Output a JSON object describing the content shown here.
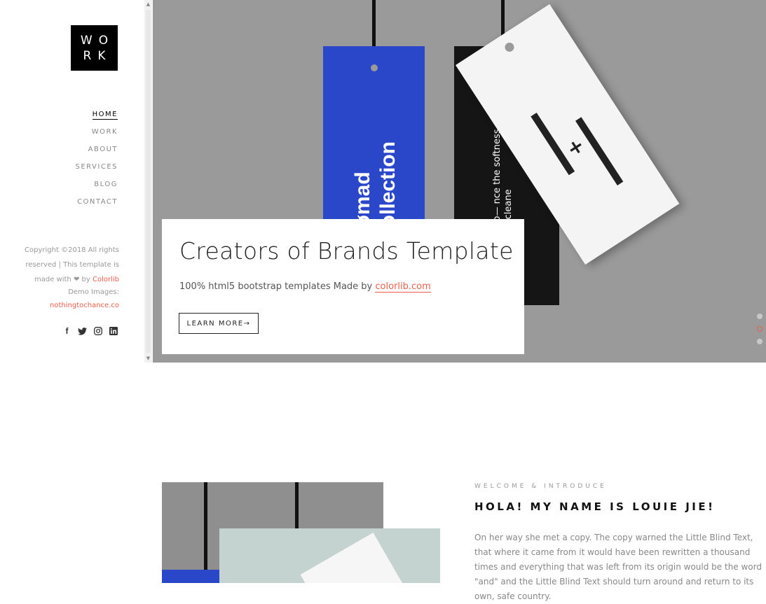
{
  "logo": {
    "line1": "WO",
    "line2": "RK"
  },
  "nav": [
    {
      "label": "HOME",
      "active": true
    },
    {
      "label": "WORK"
    },
    {
      "label": "ABOUT"
    },
    {
      "label": "SERVICES"
    },
    {
      "label": "BLOG"
    },
    {
      "label": "CONTACT"
    }
  ],
  "footer": {
    "copyright_1": "Copyright ©2018 All rights",
    "copyright_2": "reserved | This template is",
    "made_with": "made with",
    "heart": "❤",
    "by": "by",
    "author": "Colorlib",
    "demo_images": "Demo Images:",
    "demo_link": "nothingtochance.co"
  },
  "social": [
    "facebook-icon",
    "twitter-icon",
    "instagram-icon",
    "linkedin-icon"
  ],
  "hero": {
    "tag_blue_line1": "Nømad",
    "tag_blue_line2": "Collection",
    "tag_black_text": "e-Washable Merino— nce the softness and merino without w the dry cleane",
    "title": "Creators of Brands Template",
    "subtitle": "100% html5 bootstrap templates Made by",
    "subtitle_link": "colorlib.com",
    "button": "LEARN MORE",
    "button_arrow": "→",
    "slides": 3,
    "active_slide": 1
  },
  "intro": {
    "kicker": "WELCOME & INTRODUCE",
    "title": "HOLA! MY NAME IS LOUIE JIE!",
    "text": "On her way she met a copy. The copy warned the Little Blind Text, that where it came from it would have been rewritten a thousand times and everything that was left from its origin would be the word \"and\" and the Little Blind Text should turn around and return to its own, safe country."
  },
  "colors": {
    "accent": "#e8604c",
    "hero_bg": "#9a9a9a",
    "tag_blue": "#2a47c9"
  }
}
